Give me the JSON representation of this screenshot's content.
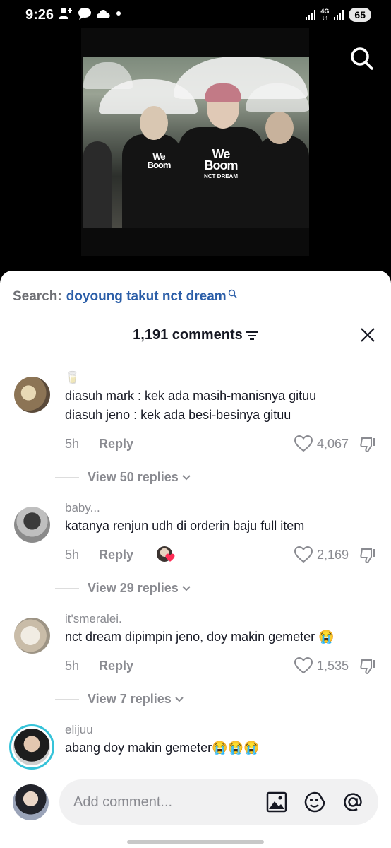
{
  "status_bar": {
    "time": "9:26",
    "battery": "65",
    "network": "4G"
  },
  "video": {
    "shirt_text_line1": "We",
    "shirt_text_line2": "Boom",
    "shirt_text_line3": "NCT DREAM"
  },
  "search": {
    "label": "Search:",
    "query": "doyoung takut nct dream"
  },
  "header": {
    "title": "1,191 comments"
  },
  "comments": [
    {
      "user": "🥛",
      "text_lines": [
        "diasuh mark : kek ada masih-manisnya gituu",
        "diasuh jeno : kek ada besi-besinya gituu"
      ],
      "time": "5h",
      "reply_label": "Reply",
      "likes": "4,067",
      "view_replies": "View 50 replies"
    },
    {
      "user": "baby...",
      "text_lines": [
        "katanya renjun udh di orderin baju full item"
      ],
      "time": "5h",
      "reply_label": "Reply",
      "likes": "2,169",
      "view_replies": "View 29 replies"
    },
    {
      "user": "it'smeralei.",
      "text_lines": [
        "nct dream dipimpin jeno, doy makin gemeter 😭"
      ],
      "time": "5h",
      "reply_label": "Reply",
      "likes": "1,535",
      "view_replies": "View 7 replies"
    },
    {
      "user": "elijuu",
      "text_lines": [
        "abang doy makin gemeter😭😭😭"
      ]
    }
  ],
  "composer": {
    "placeholder": "Add comment..."
  },
  "icons": {
    "search": "search-icon",
    "sort": "sort-icon",
    "close": "close-icon",
    "heart": "heart-icon",
    "dislike": "dislike-icon",
    "chevron": "chevron-down-icon",
    "image": "image-icon",
    "emoji": "emoji-icon",
    "mention": "mention-icon"
  },
  "colors": {
    "accent": "#2b5ea8",
    "muted": "#8a8b91",
    "text": "#161823",
    "story_ring": "#36c3d9"
  }
}
